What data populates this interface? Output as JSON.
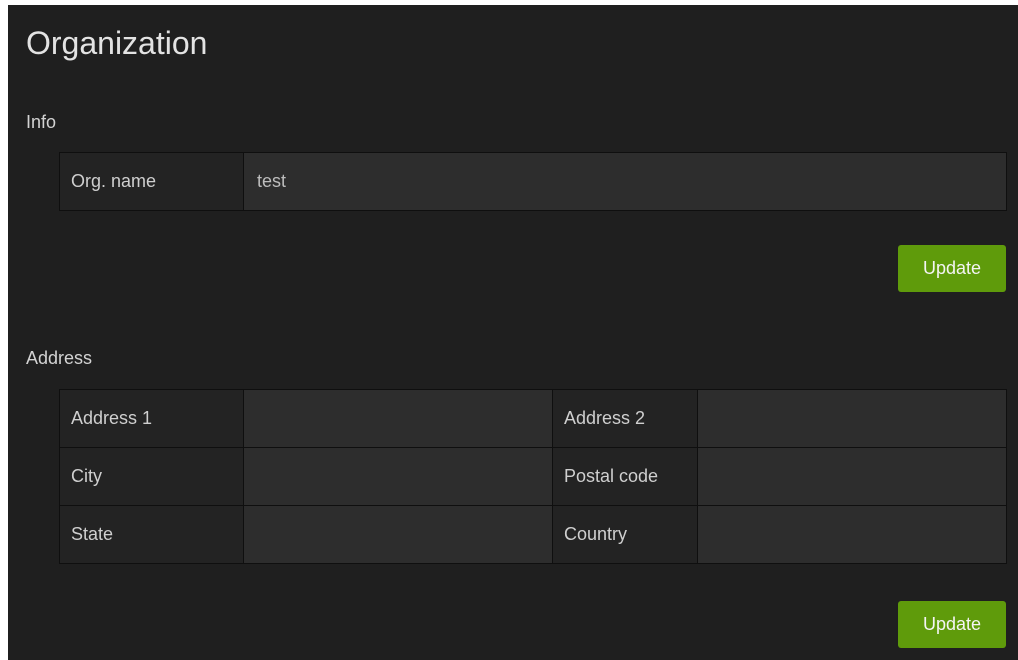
{
  "page": {
    "title": "Organization"
  },
  "info": {
    "section_title": "Info",
    "org_name_label": "Org. name",
    "org_name_value": "test",
    "update_label": "Update"
  },
  "address": {
    "section_title": "Address",
    "address1_label": "Address 1",
    "address1_value": "",
    "address2_label": "Address 2",
    "address2_value": "",
    "city_label": "City",
    "city_value": "",
    "postal_code_label": "Postal code",
    "postal_code_value": "",
    "state_label": "State",
    "state_value": "",
    "country_label": "Country",
    "country_value": "",
    "update_label": "Update"
  },
  "colors": {
    "panel_background": "#1f1f1f",
    "label_cell": "#232323",
    "input_cell": "#2d2d2d",
    "button_accent": "#5f9b0b"
  }
}
